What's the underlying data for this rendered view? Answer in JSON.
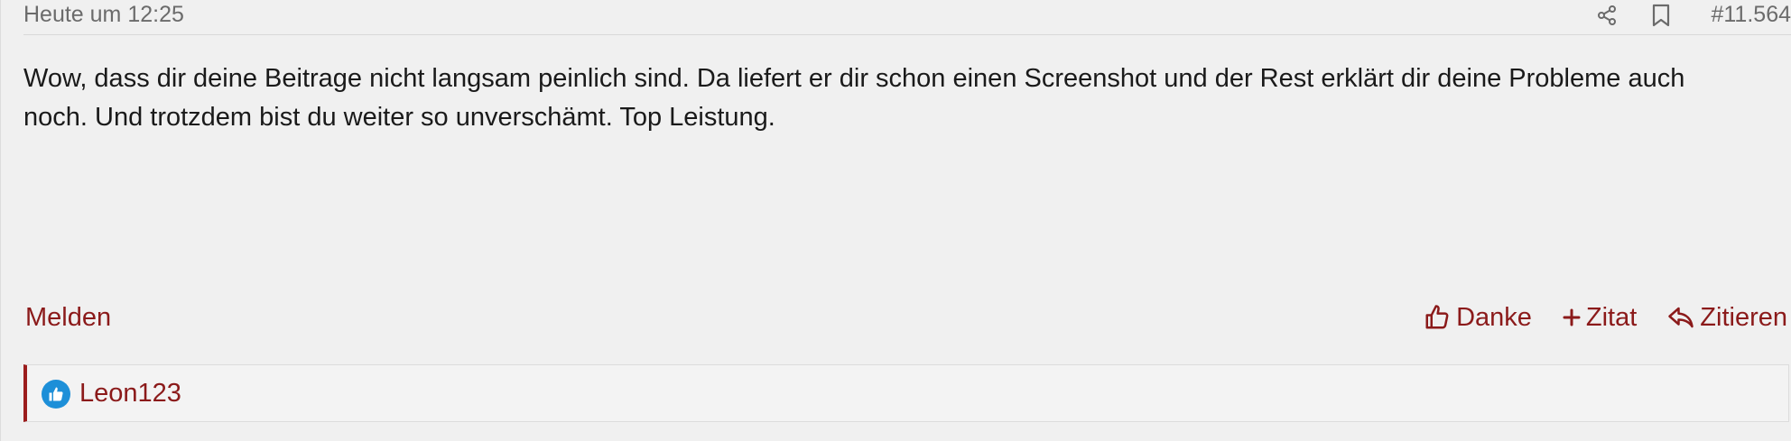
{
  "post": {
    "timestamp": "Heute um 12:25",
    "number": "#11.564",
    "icons": {
      "share": "share-icon",
      "bookmark": "bookmark-icon"
    },
    "body": [
      "Wow, dass dir deine Beitrage nicht langsam peinlich sind. Da liefert er dir schon einen Screenshot und der Rest erklärt dir deine Probleme auch",
      "noch. Und trotzdem bist du weiter so unverschämt. Top Leistung."
    ],
    "report_label": "Melden",
    "actions": {
      "thanks_label": "Danke",
      "quote_add_label": "Zitat",
      "reply_label": "Zitieren"
    },
    "likes": {
      "icon": "thumbs-up-icon",
      "users": [
        "Leon123"
      ]
    }
  },
  "colors": {
    "accent": "#8b1a1a",
    "like_badge": "#1d8fd8",
    "meta_text": "#6b6b6b",
    "body_text": "#1a1a1a",
    "background": "#f0f0f0"
  }
}
